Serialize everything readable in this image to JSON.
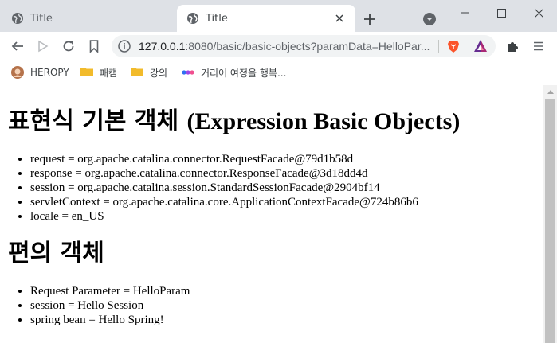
{
  "browser": {
    "tabs": [
      {
        "title": "Title",
        "active": false
      },
      {
        "title": "Title",
        "active": true
      }
    ],
    "address": {
      "host": "127.0.0.1",
      "path": ":8080/basic/basic-objects?paramData=HelloPar..."
    },
    "bookmarks": [
      {
        "label": "HEROPY",
        "icon": "avatar-icon"
      },
      {
        "label": "패캠",
        "icon": "folder-icon"
      },
      {
        "label": "강의",
        "icon": "folder-icon"
      },
      {
        "label": "커리어 여정을 행복...",
        "icon": "dots-logo-icon"
      }
    ],
    "colors": {
      "tabstrip": "#dee1e6",
      "folder": "#f2bb2b",
      "brave": "#fb542b",
      "bat": "#662d91",
      "scroll_thumb": "#c1c1c1"
    }
  },
  "page": {
    "heading1_ko": "표현식 기본 객체",
    "heading1_en": "(Expression Basic Objects)",
    "basic_objects": [
      "request = org.apache.catalina.connector.RequestFacade@79d1b58d",
      "response = org.apache.catalina.connector.ResponseFacade@3d18dd4d",
      "session = org.apache.catalina.session.StandardSessionFacade@2904bf14",
      "servletContext = org.apache.catalina.core.ApplicationContextFacade@724b86b6",
      "locale = en_US"
    ],
    "heading2": "편의 객체",
    "convenience_objects": [
      "Request Parameter = HelloParam",
      "session = Hello Session",
      "spring bean = Hello Spring!"
    ]
  }
}
